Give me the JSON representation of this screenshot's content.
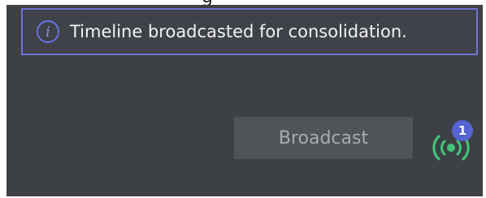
{
  "top_strip": {
    "text": "g"
  },
  "notification": {
    "icon": "info-icon",
    "message": "Timeline broadcasted for consolidation."
  },
  "broadcast": {
    "button_label": "Broadcast",
    "signal_icon": "broadcast-signal-icon",
    "badge_count": "1",
    "colors": {
      "signal": "#43c67a",
      "badge": "#5563d3"
    }
  },
  "colors": {
    "panel_bg": "#3d4145",
    "notice_border": "#7072d3",
    "button_bg": "#505459"
  }
}
